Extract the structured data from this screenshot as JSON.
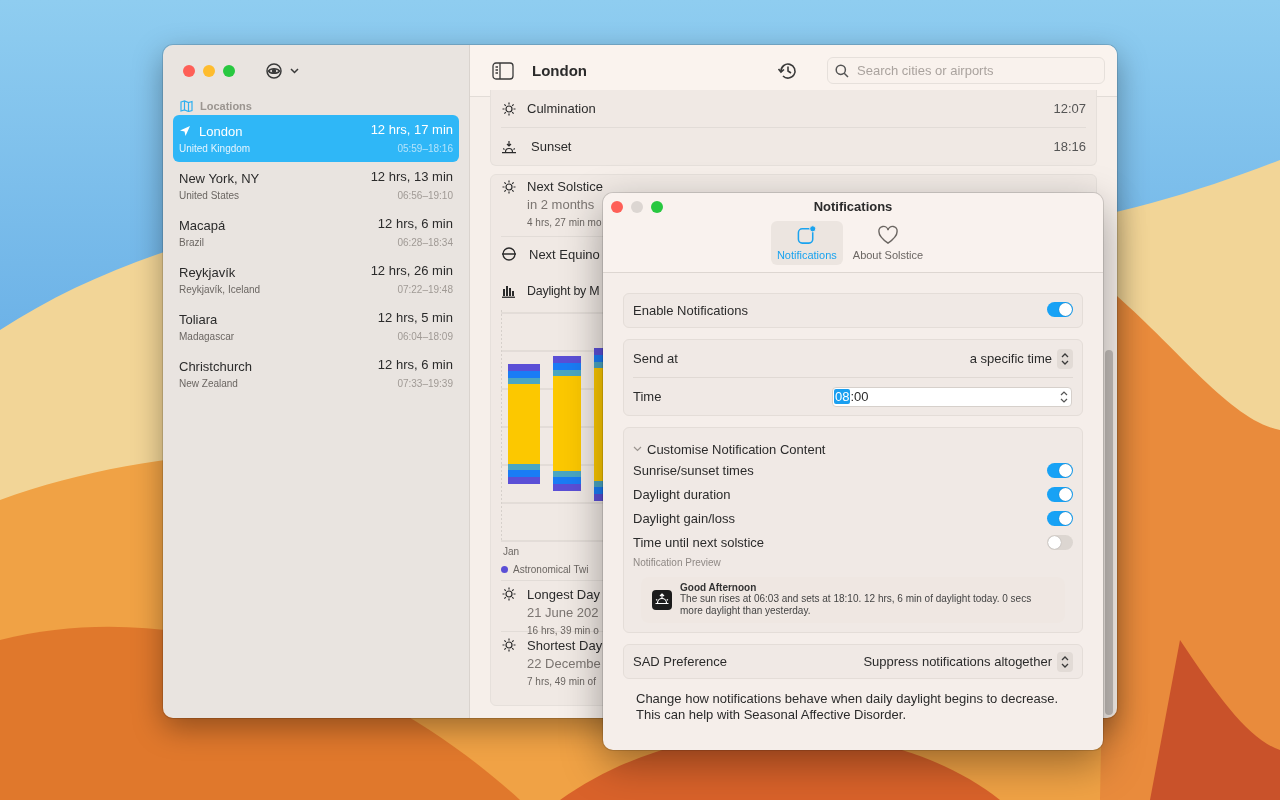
{
  "sidebar": {
    "section": "Locations",
    "items": [
      {
        "name": "London",
        "region": "United Kingdom",
        "duration": "12 hrs, 17 min",
        "times": "05:59–18:16",
        "located": true,
        "selected": true
      },
      {
        "name": "New York, NY",
        "region": "United States",
        "duration": "12 hrs, 13 min",
        "times": "06:56–19:10",
        "located": false,
        "selected": false
      },
      {
        "name": "Macapá",
        "region": "Brazil",
        "duration": "12 hrs, 6 min",
        "times": "06:28–18:34",
        "located": false,
        "selected": false
      },
      {
        "name": "Reykjavík",
        "region": "Reykjavík, Iceland",
        "duration": "12 hrs, 26 min",
        "times": "07:22–19:48",
        "located": false,
        "selected": false
      },
      {
        "name": "Toliara",
        "region": "Madagascar",
        "duration": "12 hrs, 5 min",
        "times": "06:04–18:09",
        "located": false,
        "selected": false
      },
      {
        "name": "Christchurch",
        "region": "New Zealand",
        "duration": "12 hrs, 6 min",
        "times": "07:33–19:39",
        "located": false,
        "selected": false
      }
    ]
  },
  "toolbar": {
    "title": "London",
    "search": {
      "placeholder": "Search cities or airports"
    }
  },
  "detail": {
    "sun_rows": [
      {
        "kind": "sun",
        "label": "Culmination",
        "time": "12:07"
      },
      {
        "kind": "sunset",
        "label": "Sunset",
        "time": "18:16"
      }
    ],
    "events": [
      {
        "kind": "solstice",
        "title": "Next Solstice",
        "when": "in 2 months",
        "note": "4 hrs, 27 min mo"
      },
      {
        "kind": "equinox",
        "title": "Next Equino"
      }
    ],
    "chart": {
      "title": "Daylight by M",
      "month": "Jan",
      "legend": "Astronomical Twi"
    },
    "extremes": [
      {
        "title": "Longest Day",
        "date": "21 June 202",
        "note": "16 hrs, 39 min o"
      },
      {
        "title": "Shortest Day",
        "date": "22 Decembe",
        "note": "7 hrs, 49 min of"
      }
    ]
  },
  "notifications": {
    "title": "Notifications",
    "tabs": [
      {
        "kind": "bell",
        "label": "Notifications",
        "selected": true
      },
      {
        "kind": "heart",
        "label": "About Solstice",
        "selected": false
      }
    ],
    "enable": {
      "label": "Enable Notifications",
      "on": true
    },
    "send_at": {
      "label": "Send at",
      "value": "a specific time"
    },
    "time": {
      "label": "Time",
      "hours": "08",
      "rest": ":00"
    },
    "content": {
      "title": "Customise Notification Content",
      "expanded": true,
      "options": [
        {
          "label": "Sunrise/sunset times",
          "on": true
        },
        {
          "label": "Daylight duration",
          "on": true
        },
        {
          "label": "Daylight gain/loss",
          "on": true
        },
        {
          "label": "Time until next solstice",
          "on": false
        }
      ]
    },
    "preview": {
      "label": "Notification Preview",
      "title": "Good Afternoon",
      "body": "The sun rises at 06:03 and sets at 18:10. 12 hrs, 6 min of daylight today. 0 secs more daylight than yesterday."
    },
    "sad": {
      "label": "SAD Preference",
      "value": "Suppress notifications altogether"
    },
    "footnote": "Change how notifications behave when daily daylight begins to decrease. This can help with Seasonal Affective Disorder."
  }
}
